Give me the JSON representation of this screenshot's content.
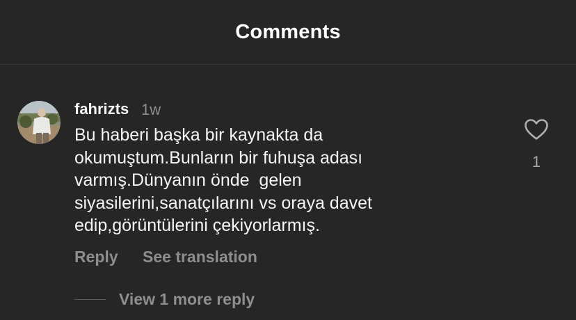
{
  "header": {
    "title": "Comments"
  },
  "comment": {
    "avatar_icon": "user-avatar-photo",
    "username": "fahrizts",
    "time": "1w",
    "text_lines": [
      "Bu haberi başka bir kaynakta da",
      "okumuştum.Bunların bir fuhuşa adası",
      "varmış.Dünyanın önde  gelen",
      "siyasilerini,sanatçılarını vs oraya davet",
      "edip,görüntülerini çekiyorlarmış."
    ],
    "like_icon": "heart-outline-icon",
    "like_count": "1",
    "reply_label": "Reply",
    "translate_label": "See translation",
    "view_replies_label": "View 1 more reply"
  },
  "colors": {
    "background": "#262626",
    "text_primary": "#f5f5f5",
    "text_secondary": "#8e8e8e"
  }
}
